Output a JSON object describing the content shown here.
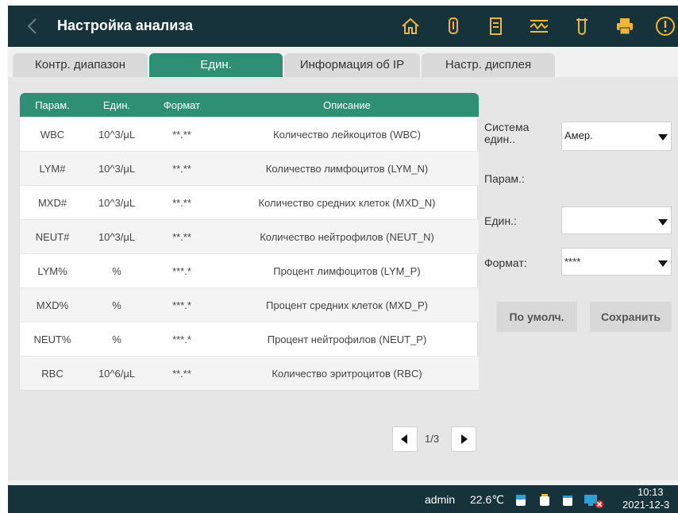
{
  "header": {
    "title": "Настройка анализа"
  },
  "tabs": [
    {
      "label": "Контр. диапазон",
      "active": false
    },
    {
      "label": "Един.",
      "active": true
    },
    {
      "label": "Информация об IP",
      "active": false
    },
    {
      "label": "Настр. дисплея",
      "active": false
    }
  ],
  "table": {
    "columns": [
      "Парам.",
      "Един.",
      "Формат",
      "Описание"
    ],
    "rows": [
      [
        "WBC",
        "10^3/μL",
        "**.**",
        "Количество лейкоцитов (WBC)"
      ],
      [
        "LYM#",
        "10^3/μL",
        "**.**",
        "Количество лимфоцитов (LYM_N)"
      ],
      [
        "MXD#",
        "10^3/μL",
        "**.**",
        "Количество средних клеток (MXD_N)"
      ],
      [
        "NEUT#",
        "10^3/μL",
        "**.**",
        "Количество нейтрофилов (NEUT_N)"
      ],
      [
        "LYM%",
        "%",
        "***.*",
        "Процент лимфоцитов (LYM_P)"
      ],
      [
        "MXD%",
        "%",
        "***.*",
        "Процент средних клеток (MXD_P)"
      ],
      [
        "NEUT%",
        "%",
        "***.*",
        "Процент нейтрофилов (NEUT_P)"
      ],
      [
        "RBC",
        "10^6/μL",
        "**.**",
        "Количество эритроцитов (RBC)"
      ]
    ]
  },
  "form": {
    "unit_system_label": "Система един..",
    "unit_system_value": "Амер.",
    "param_label": "Парам.:",
    "unit_label": "Един.:",
    "unit_value": "",
    "format_label": "Формат:",
    "format_value": "****",
    "default_button": "По умолч.",
    "save_button": "Сохранить"
  },
  "pager": {
    "page": "1/3"
  },
  "status": {
    "user": "admin",
    "temperature": "22.6℃",
    "time": "10:13",
    "date": "2021-12-3"
  },
  "colors": {
    "header_bg": "#16323b",
    "accent": "#2e8f74",
    "warning_icon": "#f2b535"
  }
}
